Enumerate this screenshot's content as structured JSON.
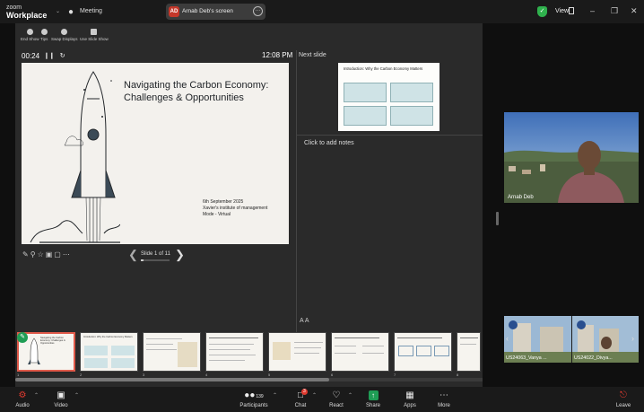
{
  "app": {
    "brand_line1": "zoom",
    "brand_line2": "Workplace",
    "meeting_label": "Meeting"
  },
  "screen_share": {
    "initials": "AD",
    "label": "Arnab Deb's screen"
  },
  "top_right": {
    "view_label": "View"
  },
  "presenter": {
    "toolbar": [
      {
        "label": "End Show"
      },
      {
        "label": "Tips"
      },
      {
        "label": "Swap Displays"
      },
      {
        "label": "Use Slide Show"
      }
    ],
    "timer": "00:24",
    "clock": "12:08 PM",
    "current_slide": {
      "title_line1": "Navigating the Carbon Economy:",
      "title_line2": "Challenges & Opportunities",
      "footer_line1": "6th September 2025",
      "footer_line2": "Xavier's institute of management",
      "footer_line3": "Mode - Virtual"
    },
    "slide_counter": "Slide 1 of 11",
    "progress": 0.09,
    "next_slide_label": "Next slide",
    "next_slide_title": "Introduction: Why the Carbon Economy Matters",
    "notes_placeholder": "Click to add notes",
    "font_controls": "A A",
    "thumbnails": [
      {
        "num": "1",
        "title": "Navigating the Carbon Economy: Challenges & Opportunities"
      },
      {
        "num": "2",
        "title": "Introduction: Why the Carbon Economy Matters"
      },
      {
        "num": "3",
        "title": ""
      },
      {
        "num": "4",
        "title": ""
      },
      {
        "num": "5",
        "title": ""
      },
      {
        "num": "6",
        "title": ""
      },
      {
        "num": "7",
        "title": ""
      },
      {
        "num": "8",
        "title": ""
      }
    ]
  },
  "participants_video": {
    "main": {
      "name": "Arnab Deb"
    },
    "strip": [
      {
        "name": "US24063_Vanya ..."
      },
      {
        "name": "US24022_Divya..."
      }
    ]
  },
  "bottom_bar": {
    "audio": "Audio",
    "video": "Video",
    "participants": "Participants",
    "participant_count": "139",
    "chat": "Chat",
    "chat_badge": "3",
    "react": "React",
    "share": "Share",
    "apps": "Apps",
    "more": "More",
    "leave": "Leave"
  },
  "colors": {
    "accent_red": "#e03a2f",
    "share_green": "#1f9d55",
    "shield_green": "#2fb14d"
  }
}
